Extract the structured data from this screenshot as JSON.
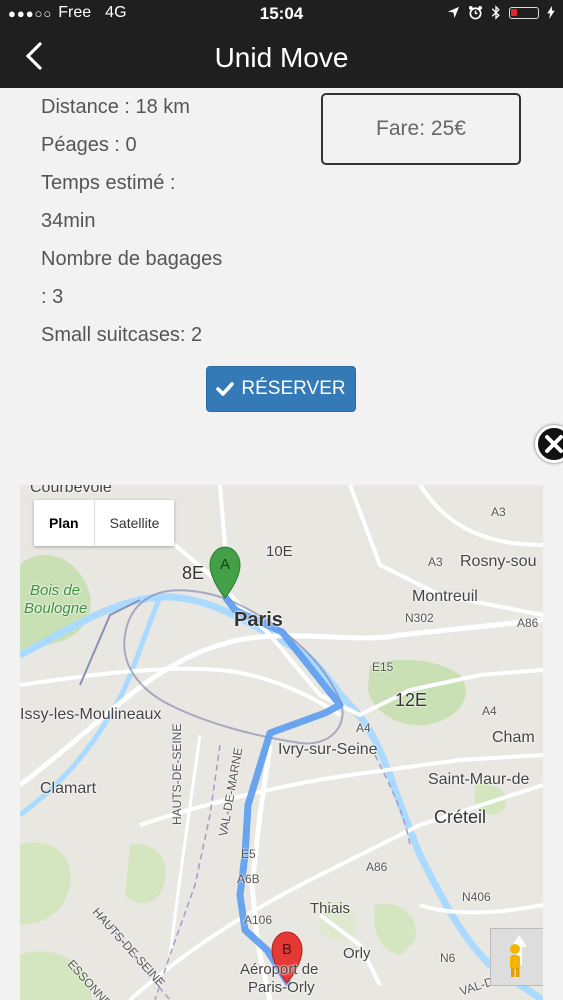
{
  "status_bar": {
    "carrier": "Free",
    "network": "4G",
    "time": "15:04",
    "battery_color": "#e0262b"
  },
  "header": {
    "back_icon": "chevron-left-icon",
    "title": "Unid Move"
  },
  "trip_info": {
    "lines": [
      "Distance : 18 km",
      "Péages : 0",
      "Temps estimé :",
      "34min",
      "Nombre de bagages",
      ": 3",
      "Small suitcases: 2"
    ]
  },
  "fare": {
    "label": "Fare: 25€"
  },
  "reserve_button": {
    "label": "RÉSERVER",
    "icon": "check-icon",
    "color": "#337ab7"
  },
  "map": {
    "type_options": [
      "Plan",
      "Satellite"
    ],
    "selected_type": "Plan",
    "route_color": "#5b9cf0",
    "markers": [
      {
        "letter": "A",
        "color": "#43a047"
      },
      {
        "letter": "B",
        "color": "#e53935"
      }
    ],
    "labels": {
      "courbevoie": "Courbevoie",
      "arr_8": "8E",
      "arr_10": "10E",
      "paris": "Paris",
      "bois_line1": "Bois de",
      "bois_line2": "Boulogne",
      "rosny": "Rosny-sou",
      "montreuil": "Montreuil",
      "arr_12": "12E",
      "issy": "Issy-les-Moulineaux",
      "ivry": "Ivry-sur-Seine",
      "cham": "Cham",
      "clamart": "Clamart",
      "saint_maur": "Saint-Maur-de",
      "creteil": "Créteil",
      "thiais": "Thiais",
      "orly": "Orly",
      "airport_line1": "Aéroport de",
      "airport_line2": "Paris-Orly",
      "hauts_de_seine_1": "HAUTS-DE-SEINE",
      "hauts_de_seine_2": "HAUTS-DE-SEINE",
      "val_de_marne": "VAL-DE-MARNE",
      "essonne": "ESSONNE",
      "val_de_marne_2": "VAL-DE-MAR",
      "a3": "A3",
      "a3b": "A3",
      "a86": "A86",
      "n302": "N302",
      "e15": "E15",
      "a4": "A4",
      "a4b": "A4",
      "a86b": "A86",
      "n406": "N406",
      "n6": "N6",
      "e5": "E5",
      "a6b": "A6B",
      "a106": "A106"
    }
  }
}
